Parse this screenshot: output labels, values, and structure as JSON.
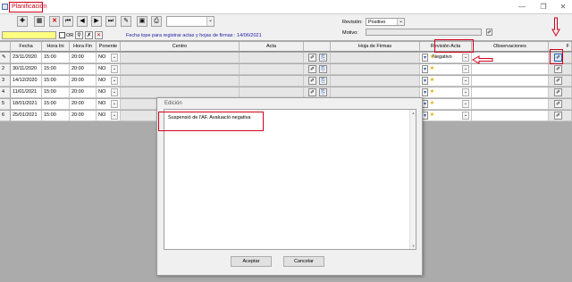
{
  "window": {
    "title": "Planificación",
    "controls": [
      "—",
      "❐",
      "✕"
    ]
  },
  "toolbar": {
    "buttons": [
      "add-icon",
      "grid-icon",
      "delete-icon",
      "first-icon",
      "prev-icon",
      "next-icon",
      "last-icon",
      "tag-icon",
      "picture-icon",
      "print-icon"
    ],
    "filter_value": "",
    "or_label": "OR",
    "revision_label": "Revisión:",
    "revision_value": "Positivo",
    "motivo_label": "Motivo:",
    "motivo_value": "",
    "fecha_tope": "Fecha tope para registrar actas y hojas de firmas : 14/06/2021"
  },
  "grid": {
    "headers": {
      "fecha": "Fecha",
      "hora_ini": "Hora Ini",
      "hora_fin": "Hora Fin",
      "ponente": "Ponente",
      "centro": "Centro",
      "acta": "Acta",
      "hoja_firmas": "Hoja de Firmas",
      "revision_acta": "Revisión Acta",
      "observaciones": "Observaciones",
      "extra": "F"
    },
    "rows": [
      {
        "num": "",
        "fecha": "23/11/2020",
        "hora_ini": "15:00",
        "hora_fin": "20:00",
        "ponente": "NO",
        "revision": "Negativo"
      },
      {
        "num": "2",
        "fecha": "30/11/2020",
        "hora_ini": "15:00",
        "hora_fin": "20:00",
        "ponente": "NO",
        "revision": ""
      },
      {
        "num": "3",
        "fecha": "14/12/2020",
        "hora_ini": "15:00",
        "hora_fin": "20:00",
        "ponente": "NO",
        "revision": ""
      },
      {
        "num": "4",
        "fecha": "11/01/2021",
        "hora_ini": "15:00",
        "hora_fin": "20:00",
        "ponente": "NO",
        "revision": ""
      },
      {
        "num": "5",
        "fecha": "18/01/2021",
        "hora_ini": "15:00",
        "hora_fin": "20:00",
        "ponente": "NO",
        "revision": ""
      },
      {
        "num": "6",
        "fecha": "25/01/2021",
        "hora_ini": "15:00",
        "hora_fin": "20:00",
        "ponente": "NO",
        "revision": ""
      }
    ]
  },
  "dialog": {
    "title": "Edición",
    "text": "Suspensió de l'AF. Avaluació negativa",
    "accept_label": "Aceptar",
    "cancel_label": "Cancelar"
  },
  "colors": {
    "annotation": "#d0021b",
    "filter_field": "#ffff80",
    "fecha_tope_text": "#1a1aa6"
  }
}
